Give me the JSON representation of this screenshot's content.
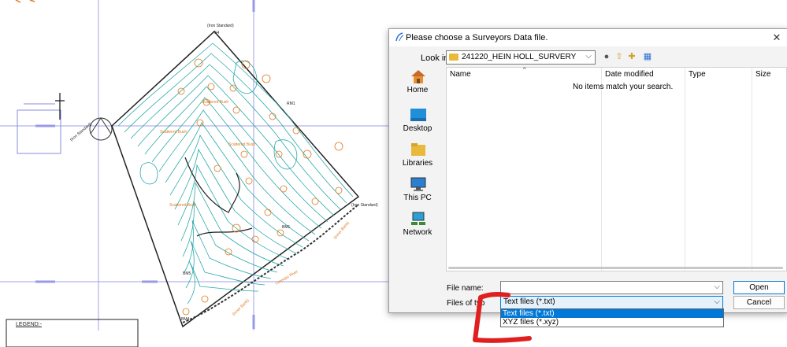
{
  "cad": {
    "labels": {
      "iron_standard_1": "(Iron Standard)",
      "iron_standard_2": "(Iron Standard)",
      "iron_standard_3": "(Iron Standard)",
      "scattered_bush_1": "Scattered Bush",
      "scattered_bush_2": "Scattered Bush",
      "scattered_bush_3": "Scattered Bush",
      "scattered_bush_4": "Scattered Bush",
      "limpopo_river": "Limpopo River",
      "inner_bank": "(Inner Bank)",
      "rm1": "RM1",
      "rm3": "RM3",
      "bm1": "BM1",
      "bm4": "BM4",
      "bm5": "BM5",
      "s4": "S4",
      "legend": "LEGEND:-"
    }
  },
  "dialog": {
    "title": "Please choose a Surveyors Data file.",
    "close_glyph": "✕",
    "look_in_label": "Look in:",
    "look_in_value": "241220_HEIN HOLL_SURVERY",
    "places": [
      {
        "label": "Home"
      },
      {
        "label": "Desktop"
      },
      {
        "label": "Libraries"
      },
      {
        "label": "This PC"
      },
      {
        "label": "Network"
      }
    ],
    "columns": {
      "name": "Name",
      "date_modified": "Date modified",
      "type": "Type",
      "size": "Size"
    },
    "empty_message": "No items match your search.",
    "file_name_label": "File name:",
    "file_name_value": "",
    "files_of_type_label": "Files of typ",
    "files_of_type_value": "Text files (*.txt)",
    "file_type_options": [
      "Text files (*.txt)",
      "XYZ files (*.xyz)"
    ],
    "open_label": "Open",
    "cancel_label": "Cancel",
    "accent_color": "#0078d7"
  }
}
